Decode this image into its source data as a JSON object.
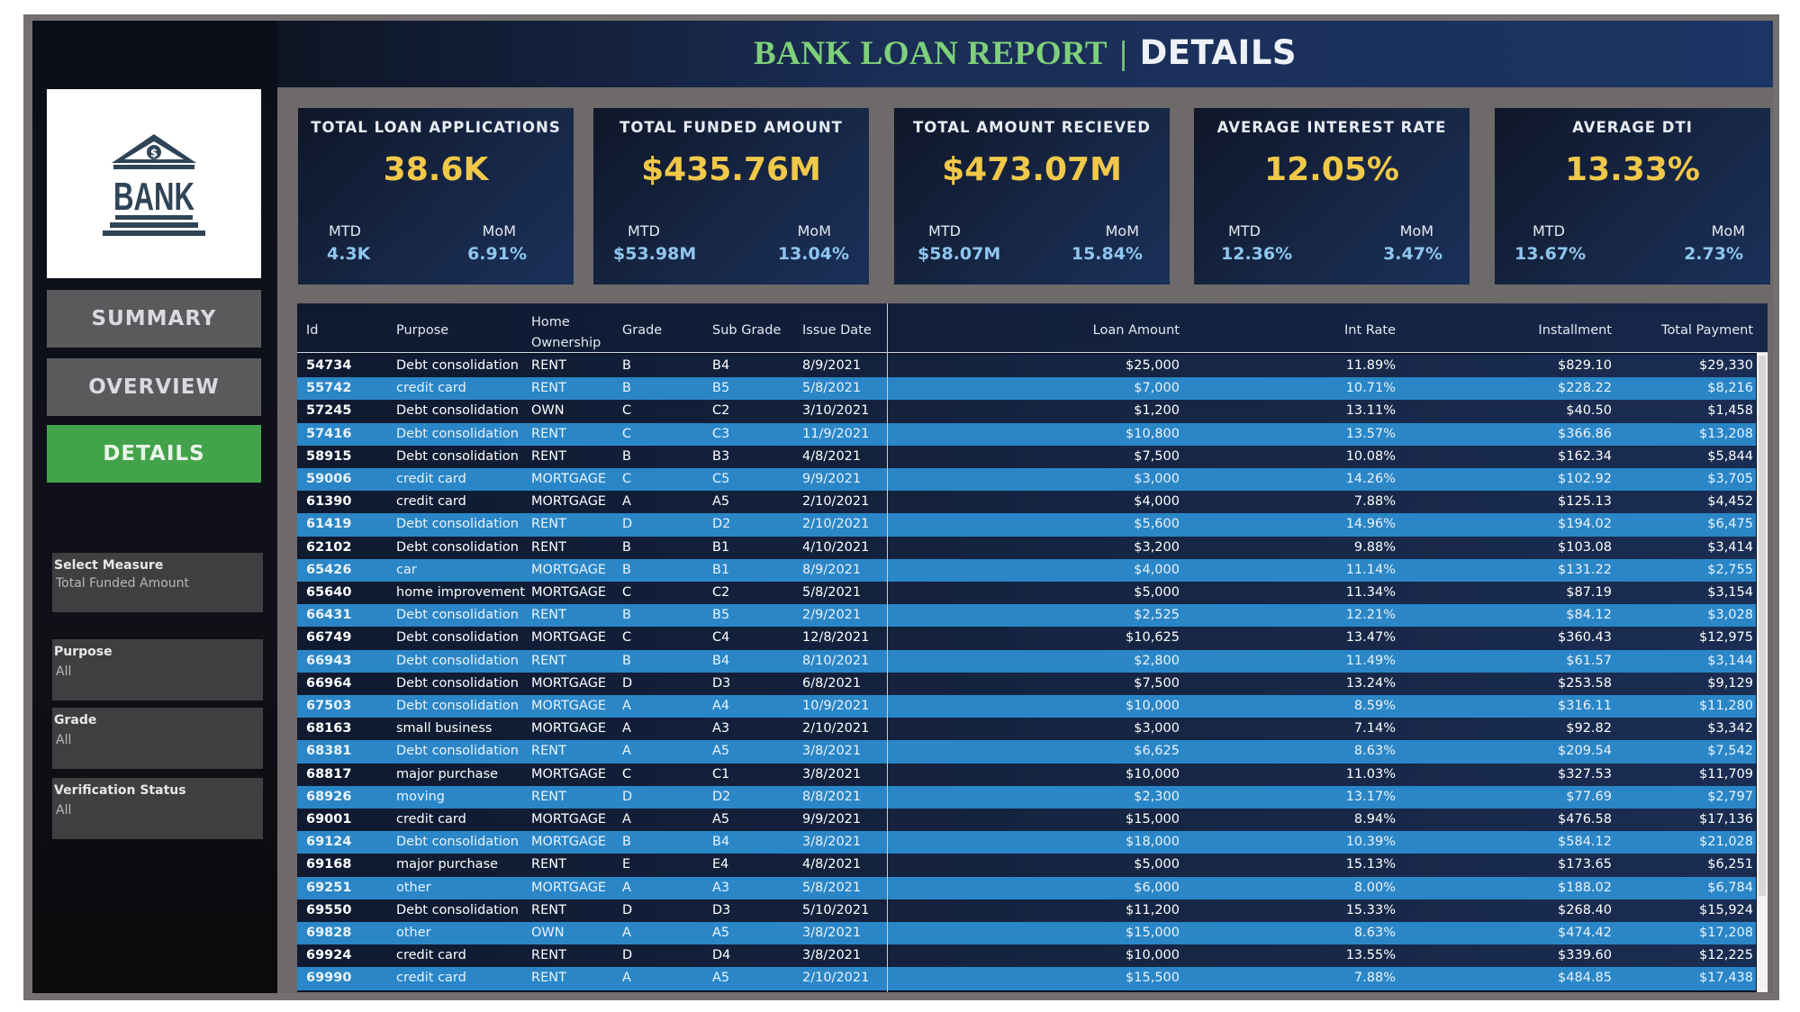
{
  "header": {
    "title_left": "BANK LOAN REPORT",
    "separator": "|",
    "title_right": "DETAILS"
  },
  "logo": {
    "text": "BANK",
    "icon": "bank-building-icon",
    "color": "#2f4456"
  },
  "nav": {
    "summary": "SUMMARY",
    "overview": "OVERVIEW",
    "details": "DETAILS"
  },
  "filters": [
    {
      "label": "Select Measure",
      "value": "Total Funded Amount"
    },
    {
      "label": "Purpose",
      "value": "All"
    },
    {
      "label": "Grade",
      "value": "All"
    },
    {
      "label": "Verification Status",
      "value": "All"
    }
  ],
  "kpis": [
    {
      "title": "TOTAL LOAN APPLICATIONS",
      "value": "38.6K",
      "mtd_label": "MTD",
      "mtd": "4.3K",
      "mom_label": "MoM",
      "mom": "6.91%"
    },
    {
      "title": "TOTAL FUNDED AMOUNT",
      "value": "$435.76M",
      "mtd_label": "MTD",
      "mtd": "$53.98M",
      "mom_label": "MoM",
      "mom": "13.04%"
    },
    {
      "title": "TOTAL AMOUNT RECIEVED",
      "value": "$473.07M",
      "mtd_label": "MTD",
      "mtd": "$58.07M",
      "mom_label": "MoM",
      "mom": "15.84%"
    },
    {
      "title": "AVERAGE INTEREST RATE",
      "value": "12.05%",
      "mtd_label": "MTD",
      "mtd": "12.36%",
      "mom_label": "MoM",
      "mom": "3.47%"
    },
    {
      "title": "AVERAGE DTI",
      "value": "13.33%",
      "mtd_label": "MTD",
      "mtd": "13.67%",
      "mom_label": "MoM",
      "mom": "2.73%"
    }
  ],
  "colors": {
    "accent_green": "#43a34a",
    "kpi_value": "#f1c84a",
    "row_highlight": "#2a86c7"
  },
  "table": {
    "headers": [
      "Id",
      "Purpose",
      "Home Ownership",
      "Grade",
      "Sub Grade",
      "Issue Date",
      "Loan Amount",
      "Int Rate",
      "Installment",
      "Total Payment"
    ],
    "rows": [
      [
        "54734",
        "Debt consolidation",
        "RENT",
        "B",
        "B4",
        "8/9/2021",
        "$25,000",
        "11.89%",
        "$829.10",
        "$29,330"
      ],
      [
        "55742",
        "credit card",
        "RENT",
        "B",
        "B5",
        "5/8/2021",
        "$7,000",
        "10.71%",
        "$228.22",
        "$8,216"
      ],
      [
        "57245",
        "Debt consolidation",
        "OWN",
        "C",
        "C2",
        "3/10/2021",
        "$1,200",
        "13.11%",
        "$40.50",
        "$1,458"
      ],
      [
        "57416",
        "Debt consolidation",
        "RENT",
        "C",
        "C3",
        "11/9/2021",
        "$10,800",
        "13.57%",
        "$366.86",
        "$13,208"
      ],
      [
        "58915",
        "Debt consolidation",
        "RENT",
        "B",
        "B3",
        "4/8/2021",
        "$7,500",
        "10.08%",
        "$162.34",
        "$5,844"
      ],
      [
        "59006",
        "credit card",
        "MORTGAGE",
        "C",
        "C5",
        "9/9/2021",
        "$3,000",
        "14.26%",
        "$102.92",
        "$3,705"
      ],
      [
        "61390",
        "credit card",
        "MORTGAGE",
        "A",
        "A5",
        "2/10/2021",
        "$4,000",
        "7.88%",
        "$125.13",
        "$4,452"
      ],
      [
        "61419",
        "Debt consolidation",
        "RENT",
        "D",
        "D2",
        "2/10/2021",
        "$5,600",
        "14.96%",
        "$194.02",
        "$6,475"
      ],
      [
        "62102",
        "Debt consolidation",
        "RENT",
        "B",
        "B1",
        "4/10/2021",
        "$3,200",
        "9.88%",
        "$103.08",
        "$3,414"
      ],
      [
        "65426",
        "car",
        "MORTGAGE",
        "B",
        "B1",
        "8/9/2021",
        "$4,000",
        "11.14%",
        "$131.22",
        "$2,755"
      ],
      [
        "65640",
        "home improvement",
        "MORTGAGE",
        "C",
        "C2",
        "5/8/2021",
        "$5,000",
        "11.34%",
        "$87.19",
        "$3,154"
      ],
      [
        "66431",
        "Debt consolidation",
        "RENT",
        "B",
        "B5",
        "2/9/2021",
        "$2,525",
        "12.21%",
        "$84.12",
        "$3,028"
      ],
      [
        "66749",
        "Debt consolidation",
        "MORTGAGE",
        "C",
        "C4",
        "12/8/2021",
        "$10,625",
        "13.47%",
        "$360.43",
        "$12,975"
      ],
      [
        "66943",
        "Debt consolidation",
        "RENT",
        "B",
        "B4",
        "8/10/2021",
        "$2,800",
        "11.49%",
        "$61.57",
        "$3,144"
      ],
      [
        "66964",
        "Debt consolidation",
        "MORTGAGE",
        "D",
        "D3",
        "6/8/2021",
        "$7,500",
        "13.24%",
        "$253.58",
        "$9,129"
      ],
      [
        "67503",
        "Debt consolidation",
        "MORTGAGE",
        "A",
        "A4",
        "10/9/2021",
        "$10,000",
        "8.59%",
        "$316.11",
        "$11,280"
      ],
      [
        "68163",
        "small business",
        "MORTGAGE",
        "A",
        "A3",
        "2/10/2021",
        "$3,000",
        "7.14%",
        "$92.82",
        "$3,342"
      ],
      [
        "68381",
        "Debt consolidation",
        "RENT",
        "A",
        "A5",
        "3/8/2021",
        "$6,625",
        "8.63%",
        "$209.54",
        "$7,542"
      ],
      [
        "68817",
        "major purchase",
        "MORTGAGE",
        "C",
        "C1",
        "3/8/2021",
        "$10,000",
        "11.03%",
        "$327.53",
        "$11,709"
      ],
      [
        "68926",
        "moving",
        "RENT",
        "D",
        "D2",
        "8/8/2021",
        "$2,300",
        "13.17%",
        "$77.69",
        "$2,797"
      ],
      [
        "69001",
        "credit card",
        "MORTGAGE",
        "A",
        "A5",
        "9/9/2021",
        "$15,000",
        "8.94%",
        "$476.58",
        "$17,136"
      ],
      [
        "69124",
        "Debt consolidation",
        "MORTGAGE",
        "B",
        "B4",
        "3/8/2021",
        "$18,000",
        "10.39%",
        "$584.12",
        "$21,028"
      ],
      [
        "69168",
        "major purchase",
        "RENT",
        "E",
        "E4",
        "4/8/2021",
        "$5,000",
        "15.13%",
        "$173.65",
        "$6,251"
      ],
      [
        "69251",
        "other",
        "MORTGAGE",
        "A",
        "A3",
        "5/8/2021",
        "$6,000",
        "8.00%",
        "$188.02",
        "$6,784"
      ],
      [
        "69550",
        "Debt consolidation",
        "RENT",
        "D",
        "D3",
        "5/10/2021",
        "$11,200",
        "15.33%",
        "$268.40",
        "$15,924"
      ],
      [
        "69828",
        "other",
        "OWN",
        "A",
        "A5",
        "3/8/2021",
        "$15,000",
        "8.63%",
        "$474.42",
        "$17,208"
      ],
      [
        "69924",
        "credit card",
        "RENT",
        "D",
        "D4",
        "3/8/2021",
        "$10,000",
        "13.55%",
        "$339.60",
        "$12,225"
      ],
      [
        "69990",
        "credit card",
        "RENT",
        "A",
        "A5",
        "2/10/2021",
        "$15,500",
        "7.88%",
        "$484.85",
        "$17,438"
      ]
    ]
  }
}
